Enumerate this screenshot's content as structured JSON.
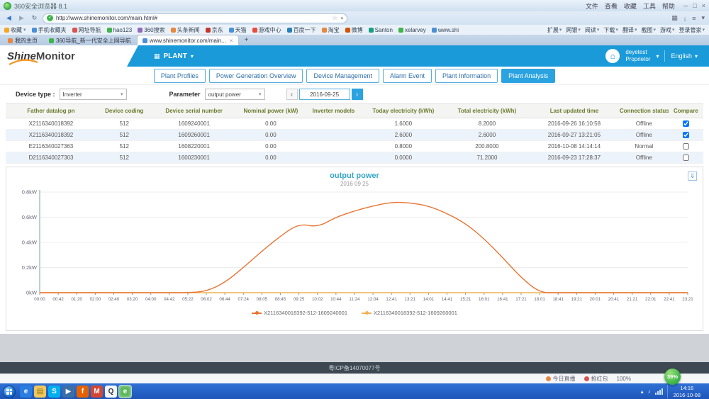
{
  "browser": {
    "window_title": "360安全浏览器 8.1",
    "menu": [
      "文件",
      "查看",
      "收藏",
      "工具",
      "帮助"
    ],
    "url": "http://www.shinemonitor.com/main.html#",
    "bookmarks": [
      "收藏",
      "手机收藏夹",
      "网址导航",
      "hao123",
      "360搜索",
      "头条新闻",
      "京东",
      "天猫",
      "游戏中心",
      "百度一下",
      "淘宝",
      "微博",
      "Santon",
      "xelarvey",
      "www.shi"
    ],
    "toolbar_right": [
      "扩展",
      "网银",
      "阅读",
      "下载",
      "翻译",
      "截图",
      "游戏",
      "登录管家"
    ],
    "tabs": [
      {
        "label": "我的主页",
        "color": "#e8873d",
        "active": false
      },
      {
        "label": "360导航_新一代安全上网导航",
        "color": "#3db54a",
        "active": false
      },
      {
        "label": "www.shinemonitor.com/main...",
        "color": "#4a90d9",
        "active": true
      }
    ],
    "status_items": [
      "今日直播",
      "抢红包",
      "100%"
    ]
  },
  "icons": {
    "close": "×",
    "minimize": "─",
    "maximize": "□",
    "back": "◀",
    "forward": "▶",
    "refresh": "↻",
    "star": "☆",
    "caret_down": "▾",
    "caret_up": "▴",
    "check": "✓",
    "house": "⌂",
    "grid": "▦",
    "plus": "+",
    "download": "↓",
    "menu": "≡",
    "prev": "‹",
    "next": "›",
    "export": "⇓",
    "note": "♪"
  },
  "app": {
    "logo_shine": "Shine",
    "logo_monitor": "Monitor",
    "nav_plant": "PLANT",
    "user_name": "deyetest",
    "user_role": "Proprietor",
    "language": "English"
  },
  "portal_tabs": [
    "Plant Profiles",
    "Power Generation Overview",
    "Device Management",
    "Alarm Event",
    "Plant Information",
    "Plant Analysis"
  ],
  "active_tab": "Plant Analysis",
  "filters": {
    "device_type_label": "Device type :",
    "device_type_value": "Inverter",
    "parameter_label": "Parameter",
    "parameter_value": "output power",
    "date": "2016-09-25"
  },
  "table": {
    "headers": [
      "Father datalog pn",
      "Device coding",
      "Device serial number",
      "Nominal power (kW)",
      "Inverter models",
      "Today electricity (kWh)",
      "Total electricity (kWh)",
      "Last updated time",
      "Connection status",
      "Compare"
    ],
    "rows": [
      {
        "pn": "X2116340018392",
        "coding": "512",
        "serial": "1609240001",
        "nominal": "0.00",
        "model": "",
        "today": "1.6000",
        "total": "8.2000",
        "updated": "2016-09-26 16:10:58",
        "status": "Offline",
        "compare": true
      },
      {
        "pn": "X2116340018392",
        "coding": "512",
        "serial": "1609260001",
        "nominal": "0.00",
        "model": "",
        "today": "2.6000",
        "total": "2.6000",
        "updated": "2016-09-27 13:21:05",
        "status": "Offline",
        "compare": true
      },
      {
        "pn": "E2116340027363",
        "coding": "512",
        "serial": "1608220001",
        "nominal": "0.00",
        "model": "",
        "today": "0.8000",
        "total": "200.8000",
        "updated": "2016-10-08 14:14:14",
        "status": "Normal",
        "compare": false
      },
      {
        "pn": "D2116340027303",
        "coding": "512",
        "serial": "1600230001",
        "nominal": "0.00",
        "model": "",
        "today": "0.0000",
        "total": "71.2000",
        "updated": "2016-09-23 17:28:37",
        "status": "Offline",
        "compare": false
      }
    ]
  },
  "chart_data": {
    "type": "line",
    "title": "output power",
    "subtitle": "2016 09 25",
    "ylabel": "kW",
    "ylim": [
      0,
      0.8
    ],
    "yticks": [
      "0kW",
      "0.2kW",
      "0.4kW",
      "0.6kW",
      "0.8kW"
    ],
    "grid": true,
    "legend_position": "bottom",
    "x": [
      "00:00",
      "00:42",
      "01:20",
      "02:00",
      "02:40",
      "03:20",
      "04:00",
      "04:42",
      "05:22",
      "06:02",
      "06:44",
      "07:24",
      "08:05",
      "08:45",
      "09:25",
      "10:02",
      "10:44",
      "11:24",
      "12:04",
      "12:41",
      "13:21",
      "14:01",
      "14:41",
      "15:21",
      "16:01",
      "16:41",
      "17:21",
      "18:01",
      "18:41",
      "19:21",
      "20:01",
      "20:41",
      "21:21",
      "22:01",
      "22:41",
      "23:21"
    ],
    "series": [
      {
        "name": "X2116340018392-512-1609240001",
        "color": "#e87432",
        "values": [
          0,
          0,
          0,
          0,
          0,
          0,
          0,
          0,
          0,
          0.01,
          0.08,
          0.2,
          0.33,
          0.45,
          0.55,
          0.52,
          0.6,
          0.65,
          0.69,
          0.72,
          0.715,
          0.69,
          0.63,
          0.55,
          0.43,
          0.28,
          0.12,
          0,
          0,
          0,
          0,
          0,
          0,
          0,
          0,
          0
        ]
      },
      {
        "name": "X2116340018392-512-1609260001",
        "color": "#f0b254",
        "values": [
          0,
          0,
          0,
          0,
          0,
          0,
          0,
          0,
          0,
          0,
          0,
          0,
          0,
          0,
          0,
          0,
          0,
          0,
          0,
          0,
          0,
          0,
          0,
          0,
          0,
          0,
          0,
          0,
          0,
          0,
          0,
          0,
          0,
          0,
          0,
          0
        ]
      }
    ]
  },
  "footer": {
    "icp": "粤ICP备14070077号"
  },
  "taskbar": {
    "items": [
      {
        "name": "ie-browser",
        "glyph": "e",
        "bg": "#2a7de1",
        "fg": "#ffffff",
        "active": false
      },
      {
        "name": "folder-explorer",
        "glyph": "▤",
        "bg": "#f0c75a",
        "fg": "#8a6d1f",
        "active": false
      },
      {
        "name": "skype",
        "glyph": "S",
        "bg": "#00aff0",
        "fg": "#ffffff",
        "active": false
      },
      {
        "name": "media-player",
        "glyph": "▶",
        "bg": "#3a6ea5",
        "fg": "#ffffff",
        "active": false
      },
      {
        "name": "firefox",
        "glyph": "f",
        "bg": "#e66000",
        "fg": "#ffffff",
        "active": false
      },
      {
        "name": "mail",
        "glyph": "M",
        "bg": "#d14836",
        "fg": "#ffffff",
        "active": false
      },
      {
        "name": "qq",
        "glyph": "Q",
        "bg": "#f2f6fa",
        "fg": "#2a2a2a",
        "active": false
      },
      {
        "name": "360-browser",
        "glyph": "e",
        "bg": "#5cb85c",
        "fg": "#ffffff",
        "active": true
      }
    ],
    "time": "14:16",
    "date": "2016-10-08",
    "speed": "39%"
  }
}
